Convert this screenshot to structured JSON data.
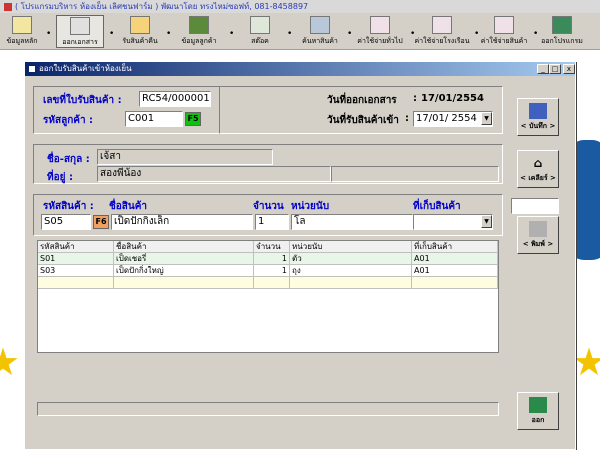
{
  "window": {
    "title": "( โปรแกรมบริหาร ห้องเย็น เลิศชนฟาร์ม ) พัฒนาโดย ทรงไหม่ซอฟท์, 081-8458897"
  },
  "toolbar": {
    "items": [
      {
        "label": "ข้อมูลหลัก",
        "icon": "document-pen-icon"
      },
      {
        "label": "ออกเอกสาร",
        "icon": "keyboard-icon"
      },
      {
        "label": "รับสินค้าคืน",
        "icon": "cart-icon"
      },
      {
        "label": "ข้อมูลลูกค้า",
        "icon": "books-icon"
      },
      {
        "label": "สต๊อค",
        "icon": "spreadsheet-icon"
      },
      {
        "label": "ค้นหาสินค้า",
        "icon": "search-computer-icon"
      },
      {
        "label": "ค่าใช้จ่ายทั่วไป",
        "icon": "document-money-icon"
      },
      {
        "label": "ค่าใช้จ่ายโรงเรือน",
        "icon": "document-house-icon"
      },
      {
        "label": "ค่าใช้จ่ายสินค้า",
        "icon": "document-goods-icon"
      },
      {
        "label": "ออกโปรแกรม",
        "icon": "exit-door-icon"
      }
    ],
    "separator": "•"
  },
  "dialog": {
    "title": "ออกใบรับสินค้าเข้าห้องเย็น",
    "min_label": "_",
    "max_label": "□",
    "close_label": "x"
  },
  "header": {
    "receipt_no_label": "เลขที่ใบรับสินค้า :",
    "receipt_no": "RC54/000001",
    "customer_code_label": "รหัสลูกค้า :",
    "customer_code": "C001",
    "f5": "F5",
    "doc_date_label": "วันที่ออกเอกสาร",
    "doc_date_colon": ":",
    "doc_date": "17/01/2554",
    "receive_date_label": "วันที่รับสินค้าเข้า",
    "receive_date_colon": ":",
    "receive_date": "17/01/ 2554"
  },
  "customer": {
    "name_label": "ชื่อ-สกุล :",
    "name": "เจ้สา",
    "address_label": "ที่อยู่ :",
    "address": "สองพี่น้อง"
  },
  "entry": {
    "product_code_label": "รหัสสินค้า :",
    "product_name_label": "ชื่อสินค้า",
    "qty_label": "จำนวน",
    "unit_label": "หน่วยนับ",
    "location_label": "ที่เก็บสินค้า",
    "product_code": "S05",
    "f6": "F6",
    "product_name": "เป็ดปักกิ่งเล็ก",
    "qty": "1",
    "unit": "โล",
    "location": ""
  },
  "table": {
    "columns": [
      "รหัสสินค้า",
      "ชื่อสินค้า",
      "จำนวน",
      "หน่วยนับ",
      "ที่เก็บสินค้า"
    ],
    "rows": [
      [
        "S01",
        "เป็ดเชอรี่",
        "1",
        "ตัว",
        "A01"
      ],
      [
        "S03",
        "เป็ดปักกิ่งใหญ่",
        "1",
        "ถุง",
        "A01"
      ]
    ]
  },
  "side": {
    "save_label": "< บันทึก >",
    "clear_label": "< เคลียร์ >",
    "print_label": "< พิมพ์ >",
    "exit_label": "ออก"
  },
  "colors": {
    "label_blue": "#0000c8",
    "f_button_green": "#10c010",
    "f6_orange": "#f0a060",
    "title_blue": "#0a246a"
  }
}
